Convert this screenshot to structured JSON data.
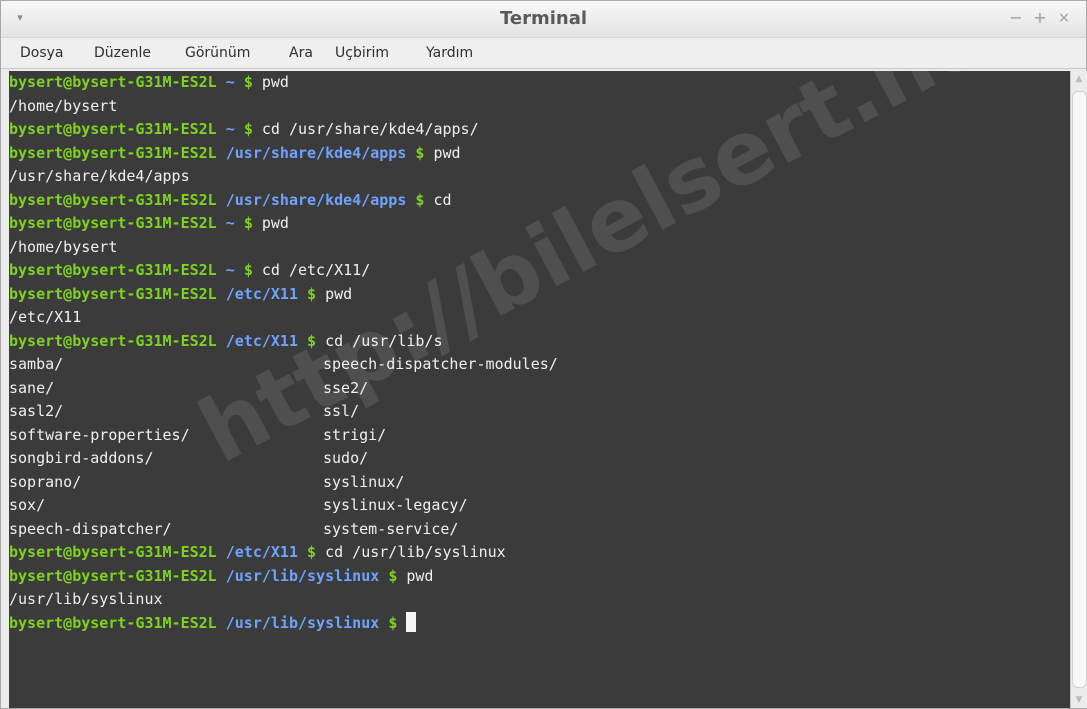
{
  "window": {
    "title": "Terminal",
    "controls": {
      "menu": "▾",
      "minimize": "−",
      "maximize": "+",
      "close": "×"
    }
  },
  "menu": {
    "items": [
      "Dosya",
      "Düzenle",
      "Görünüm",
      "Ara",
      "Uçbirim",
      "Yardım"
    ]
  },
  "terminal": {
    "prompt_user": "bysert@bysert-G31M-ES2L",
    "prompt_symbol": "$",
    "lines": [
      {
        "type": "prompt",
        "dir": "~",
        "cmd": "pwd"
      },
      {
        "type": "output",
        "text": "/home/bysert"
      },
      {
        "type": "prompt",
        "dir": "~",
        "cmd": "cd /usr/share/kde4/apps/"
      },
      {
        "type": "prompt",
        "dir": "/usr/share/kde4/apps",
        "cmd": "pwd"
      },
      {
        "type": "output",
        "text": "/usr/share/kde4/apps"
      },
      {
        "type": "prompt",
        "dir": "/usr/share/kde4/apps",
        "cmd": "cd"
      },
      {
        "type": "prompt",
        "dir": "~",
        "cmd": "pwd"
      },
      {
        "type": "output",
        "text": "/home/bysert"
      },
      {
        "type": "prompt",
        "dir": "~",
        "cmd": "cd /etc/X11/"
      },
      {
        "type": "prompt",
        "dir": "/etc/X11",
        "cmd": "pwd"
      },
      {
        "type": "output",
        "text": "/etc/X11"
      },
      {
        "type": "prompt",
        "dir": "/etc/X11",
        "cmd": "cd /usr/lib/s"
      },
      {
        "type": "columns",
        "left": "samba/",
        "right": "speech-dispatcher-modules/"
      },
      {
        "type": "columns",
        "left": "sane/",
        "right": "sse2/"
      },
      {
        "type": "columns",
        "left": "sasl2/",
        "right": "ssl/"
      },
      {
        "type": "columns",
        "left": "software-properties/",
        "right": "strigi/"
      },
      {
        "type": "columns",
        "left": "songbird-addons/",
        "right": "sudo/"
      },
      {
        "type": "columns",
        "left": "soprano/",
        "right": "syslinux/"
      },
      {
        "type": "columns",
        "left": "sox/",
        "right": "syslinux-legacy/"
      },
      {
        "type": "columns",
        "left": "speech-dispatcher/",
        "right": "system-service/"
      },
      {
        "type": "prompt",
        "dir": "/etc/X11",
        "cmd": "cd /usr/lib/syslinux"
      },
      {
        "type": "prompt",
        "dir": "/usr/lib/syslinux",
        "cmd": "pwd"
      },
      {
        "type": "output",
        "text": "/usr/lib/syslinux"
      },
      {
        "type": "prompt",
        "dir": "/usr/lib/syslinux",
        "cmd": "",
        "cursor": true
      }
    ]
  },
  "watermark": "http://bilelsert.net",
  "scrollbar": {
    "up": "▲",
    "down": "▼"
  },
  "colors": {
    "user": "#7ed321",
    "directory": "#6fa3ff",
    "background": "#3b3b3b",
    "text": "#f0f0f0"
  }
}
